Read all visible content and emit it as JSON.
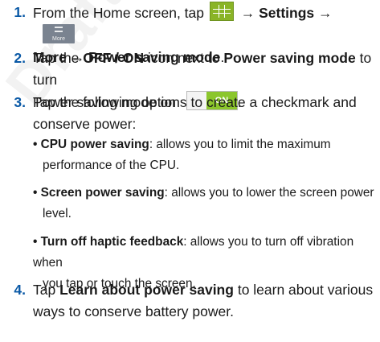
{
  "watermark": "Draft For Internal Use Only",
  "steps": [
    {
      "number": "1.",
      "line1_pre": "From the Home screen, tap",
      "arrow1": "→",
      "settings": "Settings",
      "arrow2": "→",
      "more_icon_label": "More",
      "more": "More",
      "arrow3": "→",
      "power_saving_mode": "Power saving mode",
      "end": "."
    },
    {
      "number": "2.",
      "tap": "Tap the",
      "off_on": "OFF / ON",
      "icon_next_to": "icon next to",
      "power_saving_mode": "Power saving mode",
      "to_turn": "to turn",
      "line2": "Power saving mode on",
      "toggle_label": "ON",
      "end": "."
    },
    {
      "number": "3.",
      "line1": "Tap the following options to create a checkmark and",
      "line2": "conserve power:"
    },
    {
      "number": "4.",
      "tap": "Tap",
      "learn": "Learn about power saving",
      "rest1": "to learn about various",
      "line2": "ways to conserve battery power."
    }
  ],
  "options": [
    {
      "bullet": "•",
      "name": "CPU power saving",
      "desc1": ": allows you to limit the maximum",
      "desc2": "performance of the CPU."
    },
    {
      "bullet": "•",
      "name": "Screen power saving",
      "desc1": ": allows you to lower the screen power",
      "desc2": "level."
    },
    {
      "bullet": "•",
      "name": "Turn off haptic feedback",
      "desc1": ": allows you to turn off vibration when",
      "desc2": "you tap or touch the screen."
    }
  ],
  "icons": [
    "apps-grid-icon",
    "more-icon",
    "on-toggle-icon"
  ],
  "colors": {
    "step_number": "#0a59a6",
    "apps_icon": "#8ab426",
    "toggle_on": "#8bc62c",
    "more_icon": "#7a8390"
  }
}
